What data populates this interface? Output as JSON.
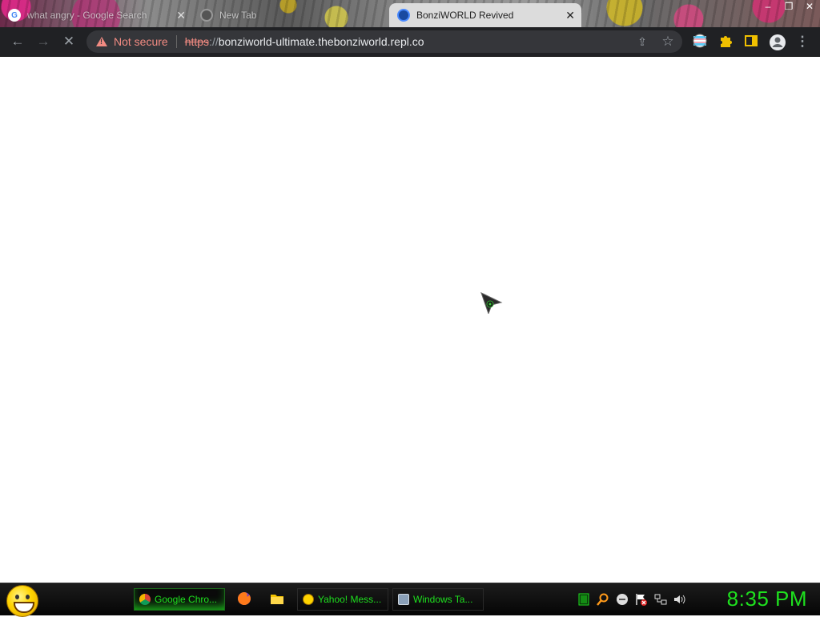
{
  "browser": {
    "tabs": [
      {
        "title": "what angry - Google Search",
        "active": false,
        "favicon": "google-icon"
      },
      {
        "title": "New Tab",
        "active": false,
        "favicon": "chrome-icon"
      },
      {
        "title": "BonziWORLD Revived",
        "active": true,
        "favicon": "bonziworld-icon"
      }
    ],
    "window_controls": {
      "minimize": "–",
      "restore": "❐",
      "close": "✕"
    },
    "omnibox": {
      "security_label": "Not secure",
      "url_scheme": "https",
      "url_separator": "://",
      "url_host": "bonziworld-ultimate.thebonziworld.repl.co"
    }
  },
  "taskbar": {
    "buttons": [
      {
        "label": "Google Chro...",
        "icon": "chrome-icon",
        "active": true
      },
      {
        "label": "Yahoo! Mess...",
        "icon": "yahoo-messenger-icon",
        "active": false
      },
      {
        "label": "Windows Ta...",
        "icon": "task-manager-icon",
        "active": false
      }
    ],
    "clock": "8:35 PM"
  },
  "colors": {
    "taskbar_text": "#1ee01e",
    "warning": "#f28b82",
    "toolbar_bg": "#202124"
  }
}
